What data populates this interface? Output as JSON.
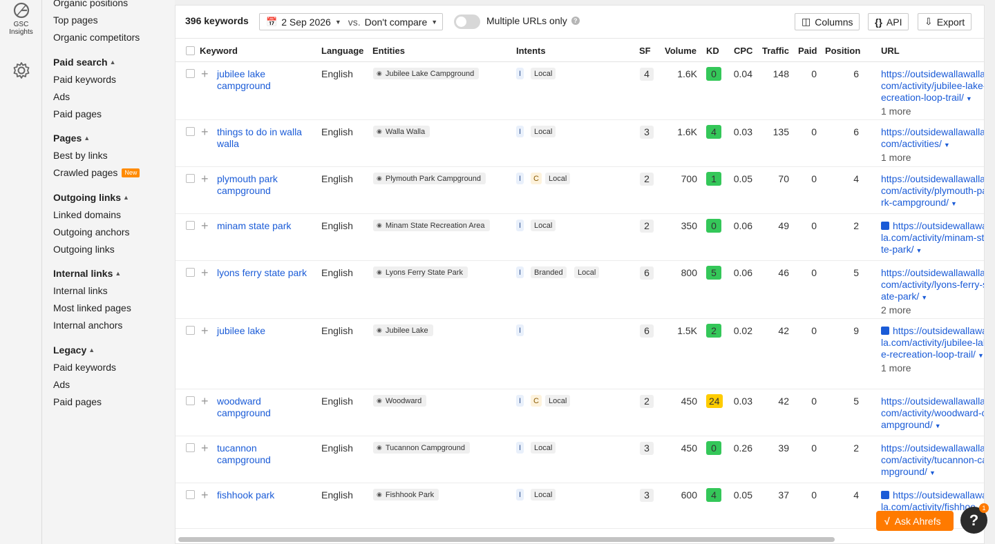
{
  "rail": {
    "gsc_label": "GSC",
    "insights_label": "Insights",
    "icons": [
      "gsc-logo-icon",
      "gear-icon"
    ]
  },
  "sidenav": {
    "groups": [
      {
        "title": "",
        "items": [
          "Organic positions",
          "Top pages",
          "Organic competitors"
        ]
      },
      {
        "title": "Paid search",
        "items": [
          "Paid keywords",
          "Ads",
          "Paid pages"
        ]
      },
      {
        "title": "Pages",
        "items": [
          "Best by links",
          "Crawled pages"
        ]
      },
      {
        "title": "Outgoing links",
        "items": [
          "Linked domains",
          "Outgoing anchors",
          "Outgoing links"
        ]
      },
      {
        "title": "Internal links",
        "items": [
          "Internal links",
          "Most linked pages",
          "Internal anchors"
        ]
      },
      {
        "title": "Legacy",
        "items": [
          "Paid keywords",
          "Ads",
          "Paid pages"
        ]
      }
    ],
    "new_badge": "New"
  },
  "toolbar": {
    "keyword_count": "396 keywords",
    "date": "2 Sep 2026",
    "vs": "vs.",
    "compare": "Don't compare",
    "multiple_urls": "Multiple URLs only",
    "columns": "Columns",
    "api": "API",
    "export": "Export"
  },
  "table": {
    "headers": [
      "Keyword",
      "Language",
      "Entities",
      "Intents",
      "SF",
      "Volume",
      "KD",
      "CPC",
      "Traffic",
      "Paid",
      "Position",
      "URL"
    ],
    "rows": [
      {
        "keyword": [
          "jubilee lake",
          "campground"
        ],
        "language": "English",
        "entity": "Jubilee Lake Campground",
        "intents": [
          "I",
          "Local"
        ],
        "sf": "4",
        "volume": "1.6K",
        "kd": "0",
        "kd_color": "#34c759",
        "cpc": "0.04",
        "traffic": "148",
        "paid": "0",
        "position": "6",
        "url_icon": false,
        "url": [
          "https://outsidewallawalla.",
          "com/activity/jubilee-lake-",
          "recreation-loop-trail/"
        ],
        "more": "1 more"
      },
      {
        "keyword": [
          "things to do in walla",
          "walla"
        ],
        "language": "English",
        "entity": "Walla Walla",
        "intents": [
          "I",
          "Local"
        ],
        "sf": "3",
        "volume": "1.6K",
        "kd": "4",
        "kd_color": "#34c759",
        "cpc": "0.03",
        "traffic": "135",
        "paid": "0",
        "position": "6",
        "url_icon": false,
        "url": [
          "https://outsidewallawalla.",
          "com/activities/"
        ],
        "more": "1 more"
      },
      {
        "keyword": [
          "plymouth park",
          "campground"
        ],
        "language": "English",
        "entity": "Plymouth Park Campground",
        "intents": [
          "I",
          "C",
          "Local"
        ],
        "sf": "2",
        "volume": "700",
        "kd": "1",
        "kd_color": "#34c759",
        "cpc": "0.05",
        "traffic": "70",
        "paid": "0",
        "position": "4",
        "url_icon": false,
        "url": [
          "https://outsidewallawalla.",
          "com/activity/plymouth-p",
          "ark-campground/"
        ],
        "more": ""
      },
      {
        "keyword": [
          "minam state park"
        ],
        "language": "English",
        "entity": "Minam State Recreation Area",
        "intents": [
          "I",
          "Local"
        ],
        "sf": "2",
        "volume": "350",
        "kd": "0",
        "kd_color": "#34c759",
        "cpc": "0.06",
        "traffic": "49",
        "paid": "0",
        "position": "2",
        "url_icon": true,
        "url": [
          "https://outsidewallawa",
          "lla.com/activity/minam-st",
          "ate-park/"
        ],
        "more": ""
      },
      {
        "keyword": [
          "lyons ferry state park"
        ],
        "language": "English",
        "entity": "Lyons Ferry State Park",
        "intents": [
          "I",
          "Branded",
          "Local"
        ],
        "sf": "6",
        "volume": "800",
        "kd": "5",
        "kd_color": "#34c759",
        "cpc": "0.06",
        "traffic": "46",
        "paid": "0",
        "position": "5",
        "url_icon": false,
        "url": [
          "https://outsidewallawalla.",
          "com/activity/lyons-ferry-",
          "state-park/"
        ],
        "more": "2 more"
      },
      {
        "keyword": [
          "jubilee lake"
        ],
        "language": "English",
        "entity": "Jubilee Lake",
        "intents": [
          "I"
        ],
        "sf": "6",
        "volume": "1.5K",
        "kd": "2",
        "kd_color": "#34c759",
        "cpc": "0.02",
        "traffic": "42",
        "paid": "0",
        "position": "9",
        "url_icon": true,
        "url": [
          "https://outsidewallawa",
          "lla.com/activity/jubilee-la",
          "ke-recreation-loop-trail/"
        ],
        "more": "1 more"
      },
      {
        "keyword": [
          "woodward",
          "campground"
        ],
        "language": "English",
        "entity": "Woodward",
        "intents": [
          "I",
          "C",
          "Local"
        ],
        "sf": "2",
        "volume": "450",
        "kd": "24",
        "kd_color": "#ffcc00",
        "cpc": "0.03",
        "traffic": "42",
        "paid": "0",
        "position": "5",
        "url_icon": false,
        "url": [
          "https://outsidewallawalla.",
          "com/activity/woodward-",
          "campground/"
        ],
        "more": ""
      },
      {
        "keyword": [
          "tucannon",
          "campground"
        ],
        "language": "English",
        "entity": "Tucannon Campground",
        "intents": [
          "I",
          "Local"
        ],
        "sf": "3",
        "volume": "450",
        "kd": "0",
        "kd_color": "#34c759",
        "cpc": "0.26",
        "traffic": "39",
        "paid": "0",
        "position": "2",
        "url_icon": false,
        "url": [
          "https://outsidewallawalla.",
          "com/activity/tucannon-c",
          "ampground/"
        ],
        "more": ""
      },
      {
        "keyword": [
          "fishhook park"
        ],
        "language": "English",
        "entity": "Fishhook Park",
        "intents": [
          "I",
          "Local"
        ],
        "sf": "3",
        "volume": "600",
        "kd": "4",
        "kd_color": "#34c759",
        "cpc": "0.05",
        "traffic": "37",
        "paid": "0",
        "position": "4",
        "url_icon": true,
        "url": [
          "https://outsidewallawa",
          "lla.com/activity/fishhoo"
        ],
        "more": ""
      }
    ]
  },
  "floating": {
    "ask_label": "Ask Ahrefs",
    "help_glyph": "?",
    "help_count": "1"
  }
}
